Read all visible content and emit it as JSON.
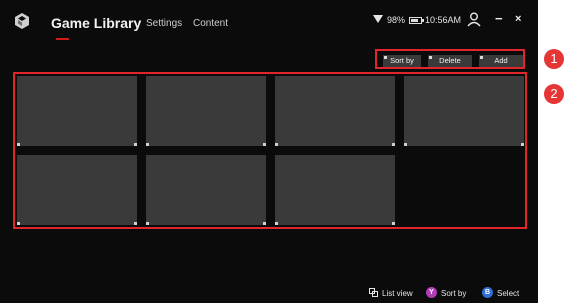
{
  "app": {
    "title": "Game Library",
    "nav": [
      "Settings",
      "Content"
    ],
    "accent_color": "#d11a1a"
  },
  "status": {
    "wifi_icon": "wifi-icon",
    "battery": "98%",
    "time": "10:56AM"
  },
  "window_controls": {
    "minimize": "−",
    "close": "×"
  },
  "toolbar": {
    "sort_label": "Sort by",
    "delete_label": "Delete",
    "add_label": "Add"
  },
  "library": {
    "tiles": 7
  },
  "footer": {
    "list_view_label": "List view",
    "sort_label": "Sort by",
    "sort_button": "Y",
    "select_label": "Select",
    "select_button": "B"
  },
  "callouts": [
    "1",
    "2"
  ],
  "highlight_color": "#e0262a"
}
